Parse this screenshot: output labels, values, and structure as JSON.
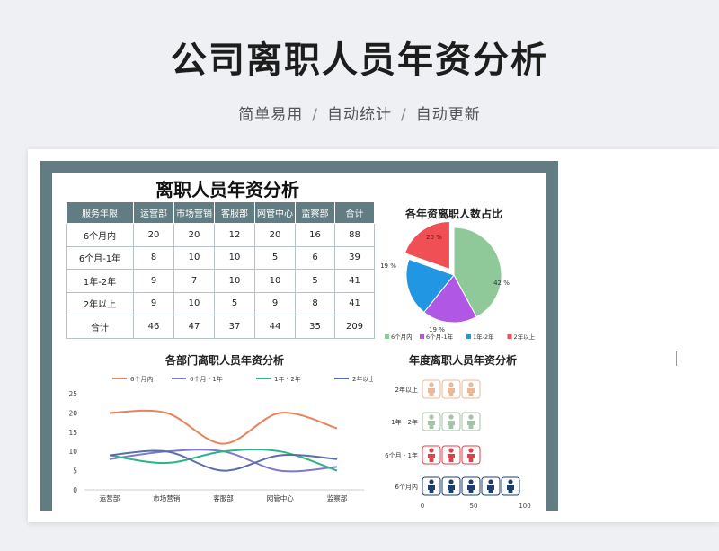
{
  "hero": {
    "title": "公司离职人员年资分析",
    "tags": [
      "简单易用",
      "自动统计",
      "自动更新"
    ],
    "separator": "/"
  },
  "sheet": {
    "title": "离职人员年资分析"
  },
  "table": {
    "headers": [
      "服务年限",
      "运营部",
      "市场营销",
      "客服部",
      "网管中心",
      "监察部",
      "合计"
    ],
    "rows": [
      [
        "6个月内",
        "20",
        "20",
        "12",
        "20",
        "16",
        "88"
      ],
      [
        "6个月-1年",
        "8",
        "10",
        "10",
        "5",
        "6",
        "39"
      ],
      [
        "1年-2年",
        "9",
        "7",
        "10",
        "10",
        "5",
        "41"
      ],
      [
        "2年以上",
        "9",
        "10",
        "5",
        "9",
        "8",
        "41"
      ],
      [
        "合计",
        "46",
        "47",
        "37",
        "44",
        "35",
        "209"
      ]
    ]
  },
  "chart_data": [
    {
      "type": "pie",
      "title": "各年资离职人数占比",
      "categories": [
        "6个月内",
        "6个月-1年",
        "1年-2年",
        "2年以上"
      ],
      "values": [
        88,
        39,
        41,
        41
      ],
      "data_labels": [
        "42 %",
        "19 %",
        "19 %",
        "20 %"
      ],
      "colors": [
        "#8fc99a",
        "#b157e6",
        "#2196e3",
        "#f04f55"
      ],
      "legend": "bottom"
    },
    {
      "type": "line",
      "title": "各部门离职人员年资分析",
      "categories": [
        "运营部",
        "市场营销",
        "客服部",
        "网管中心",
        "监察部"
      ],
      "series": [
        {
          "name": "6个月内",
          "values": [
            20,
            20,
            12,
            20,
            16
          ],
          "color": "#e8835a"
        },
        {
          "name": "6个月 - 1年",
          "values": [
            8,
            10,
            10,
            5,
            6
          ],
          "color": "#7f79c9"
        },
        {
          "name": "1年 - 2年",
          "values": [
            9,
            7,
            10,
            10,
            5
          ],
          "color": "#2bb38a"
        },
        {
          "name": "2年以上",
          "values": [
            9,
            10,
            5,
            9,
            8
          ],
          "color": "#5b6eaa"
        }
      ],
      "ylim": [
        0,
        25
      ],
      "yticks": [
        0,
        5,
        10,
        15,
        20,
        25
      ],
      "legend": "top",
      "grid": false
    },
    {
      "type": "bar",
      "title": "年度离职人员年资分析",
      "categories": [
        "2年以上",
        "1年 - 2年",
        "6个月 - 1年",
        "6个月内"
      ],
      "values": [
        41,
        41,
        39,
        88
      ],
      "colors": [
        "#e8b89a",
        "#a6c3a9",
        "#e0424a",
        "#1f3f6b"
      ],
      "icon": "person-icon",
      "xlim": [
        0,
        100
      ],
      "xticks": [
        0,
        50,
        100
      ]
    }
  ]
}
